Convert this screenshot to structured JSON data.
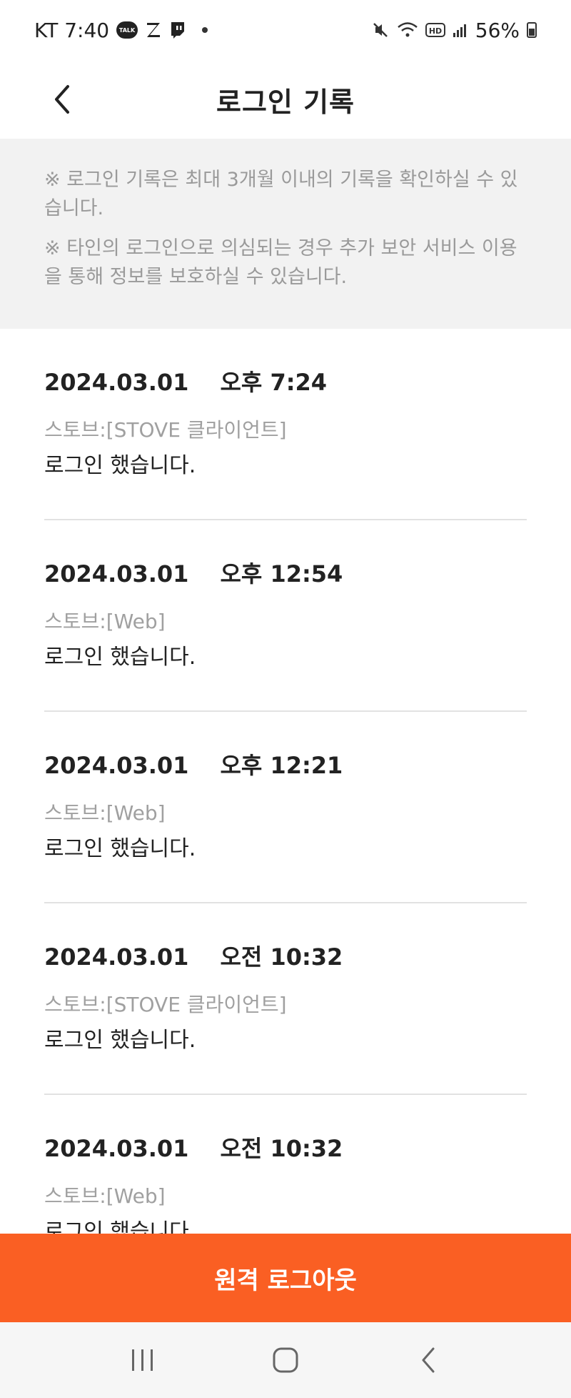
{
  "status_bar": {
    "carrier_time": "KT 7:40",
    "talk_label": "TALK",
    "battery": "56%"
  },
  "header": {
    "title": "로그인 기록"
  },
  "notice": {
    "line1": "※ 로그인 기록은 최대 3개월 이내의 기록을 확인하실 수 있습니다.",
    "line2": "※ 타인의 로그인으로 의심되는 경우 추가 보안 서비스 이용을 통해 정보를 보호하실 수 있습니다."
  },
  "logs": [
    {
      "date": "2024.03.01",
      "time": "오후 7:24",
      "source": "스토브:[STOVE 클라이언트]",
      "message": "로그인 했습니다."
    },
    {
      "date": "2024.03.01",
      "time": "오후 12:54",
      "source": "스토브:[Web]",
      "message": "로그인 했습니다."
    },
    {
      "date": "2024.03.01",
      "time": "오후 12:21",
      "source": "스토브:[Web]",
      "message": "로그인 했습니다."
    },
    {
      "date": "2024.03.01",
      "time": "오전 10:32",
      "source": "스토브:[STOVE 클라이언트]",
      "message": "로그인 했습니다."
    },
    {
      "date": "2024.03.01",
      "time": "오전 10:32",
      "source": "스토브:[Web]",
      "message": "로그인 했습니다."
    }
  ],
  "footer": {
    "logout_label": "원격 로그아웃"
  },
  "colors": {
    "accent": "#fa5f23",
    "notice_bg": "#f2f2f2"
  },
  "icons": {
    "back": "chevron-left-icon",
    "nav_recents": "recents-icon",
    "nav_home": "home-icon",
    "nav_back": "nav-back-icon"
  }
}
